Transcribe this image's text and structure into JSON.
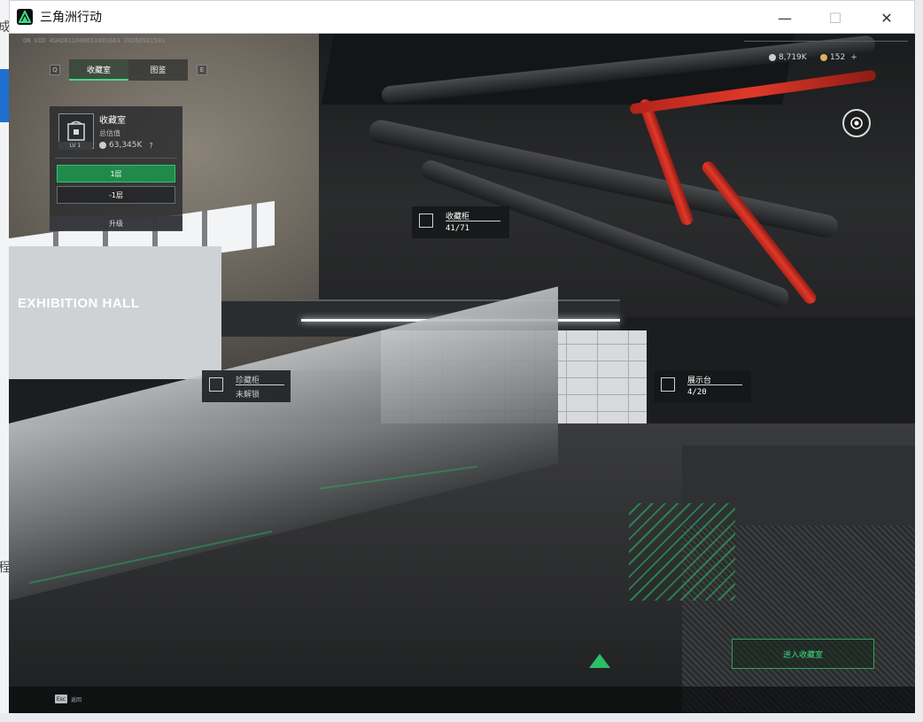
{
  "window": {
    "title": "三角洲行动",
    "controls": {
      "minimize": "—",
      "maximize": "☐",
      "close": "✕"
    }
  },
  "background_edge": {
    "char_top": "成",
    "char_mid": "程"
  },
  "hud": {
    "uid": "ON UID 4SH261160065100S663 20260921501",
    "currency_a": {
      "value": "8,719K",
      "color": "#c9ced3"
    },
    "currency_b": {
      "value": "152",
      "plus": "+",
      "color": "#d9b45c"
    },
    "view_icon": "eye-icon"
  },
  "tabs": {
    "left_key": "Q",
    "right_key": "E",
    "items": [
      {
        "label": "收藏室",
        "active": true
      },
      {
        "label": "图鉴",
        "active": false
      }
    ]
  },
  "panel": {
    "room_name": "收藏室",
    "level": "LV 1",
    "value_label": "总估值",
    "value": "63,345K",
    "help": "?",
    "floors": [
      {
        "label": "1层",
        "active": true
      },
      {
        "label": "-1层",
        "active": false
      }
    ],
    "upgrade_label": "升级"
  },
  "scene": {
    "hall_sign": "EXHIBITION HALL",
    "markers": [
      {
        "name": "收藏柜",
        "count": "41/71",
        "locked": false
      },
      {
        "name": "珍藏柜",
        "count": "未解锁",
        "locked": true
      },
      {
        "name": "展示台",
        "count": "4/20",
        "locked": false
      }
    ]
  },
  "actions": {
    "enter_label": "进入收藏室",
    "esc_key": "Esc",
    "esc_label": "返回"
  },
  "colors": {
    "accent": "#3ddc84",
    "accent_dark": "#1f8a4c",
    "pipe_red": "#e0392a"
  }
}
